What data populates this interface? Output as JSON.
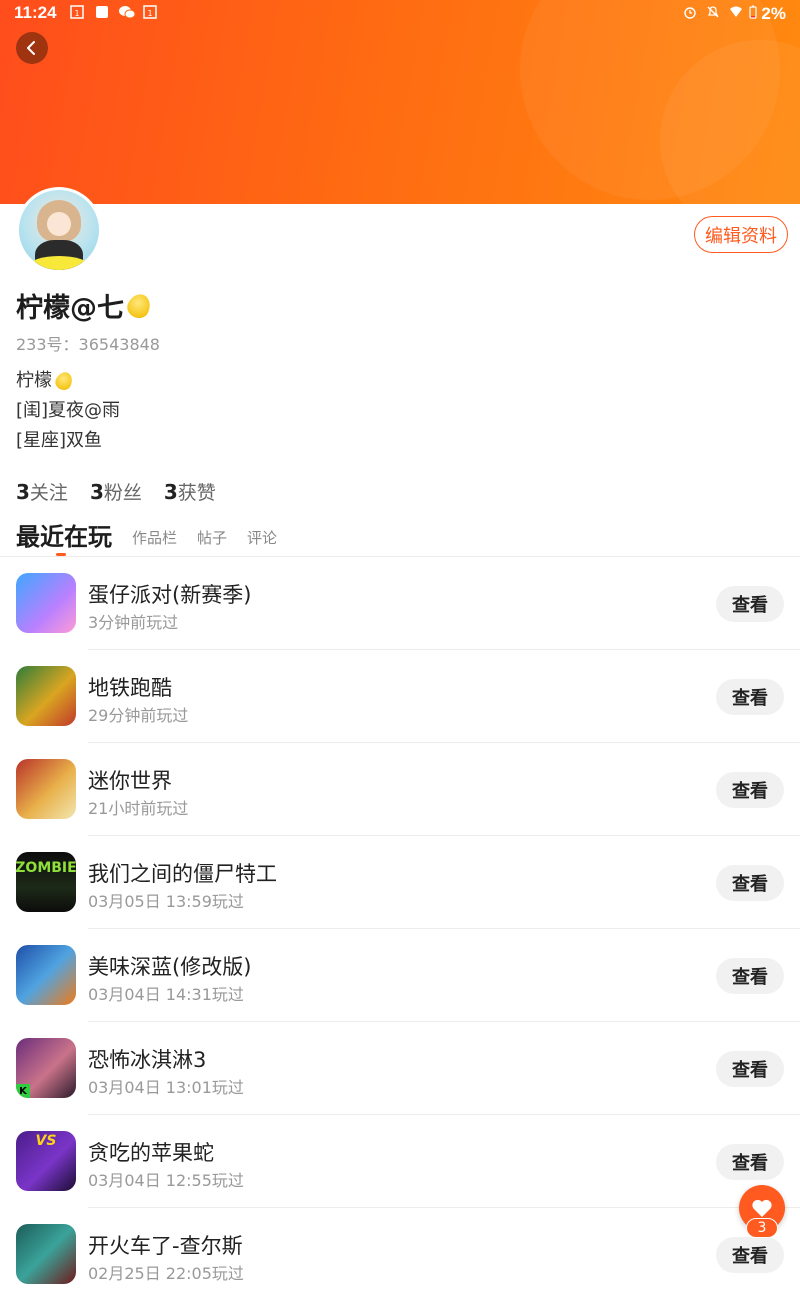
{
  "status_bar": {
    "time": "11:24",
    "battery": "2%",
    "left_icons": [
      "sim-icon",
      "square-icon",
      "wechat-icon",
      "sim-icon"
    ],
    "right_icons": [
      "alarm-icon",
      "mute-icon",
      "wifi-icon",
      "battery-icon"
    ]
  },
  "header": {
    "back_icon": "chevron-left-icon",
    "edit_label": "编辑资料"
  },
  "profile": {
    "name": "柠檬@七",
    "user_id": "233号：36543848",
    "bio": [
      "柠檬",
      "[闺]夏夜@雨",
      "[星座]双鱼"
    ],
    "stats": [
      {
        "count": "3",
        "label": "关注"
      },
      {
        "count": "3",
        "label": "粉丝"
      },
      {
        "count": "3",
        "label": "获赞"
      }
    ]
  },
  "tabs": {
    "active": "最近在玩",
    "others": [
      "作品栏",
      "帖子",
      "评论"
    ]
  },
  "games": [
    {
      "title": "蛋仔派对(新赛季)",
      "sub": "3分钟前玩过",
      "action": "查看"
    },
    {
      "title": "地铁跑酷",
      "sub": "29分钟前玩过",
      "action": "查看"
    },
    {
      "title": "迷你世界",
      "sub": "21小时前玩过",
      "action": "查看"
    },
    {
      "title": "我们之间的僵尸特工",
      "sub": "03月05日 13:59玩过",
      "action": "查看",
      "icon_text": "ZOMBIE"
    },
    {
      "title": "美味深蓝(修改版)",
      "sub": "03月04日 14:31玩过",
      "action": "查看"
    },
    {
      "title": "恐怖冰淇淋3",
      "sub": "03月04日 13:01玩过",
      "action": "查看",
      "icon_text": "K"
    },
    {
      "title": "贪吃的苹果蛇",
      "sub": "03月04日 12:55玩过",
      "action": "查看",
      "icon_text": "VS"
    },
    {
      "title": "开火车了-查尔斯",
      "sub": "02月25日 22:05玩过",
      "action": "查看"
    }
  ],
  "fab": {
    "icon": "heart-icon",
    "count": "3"
  },
  "colors": {
    "accent": "#ff5a1f",
    "banner_start": "#ff4d1c",
    "banner_end": "#ff8a10"
  }
}
